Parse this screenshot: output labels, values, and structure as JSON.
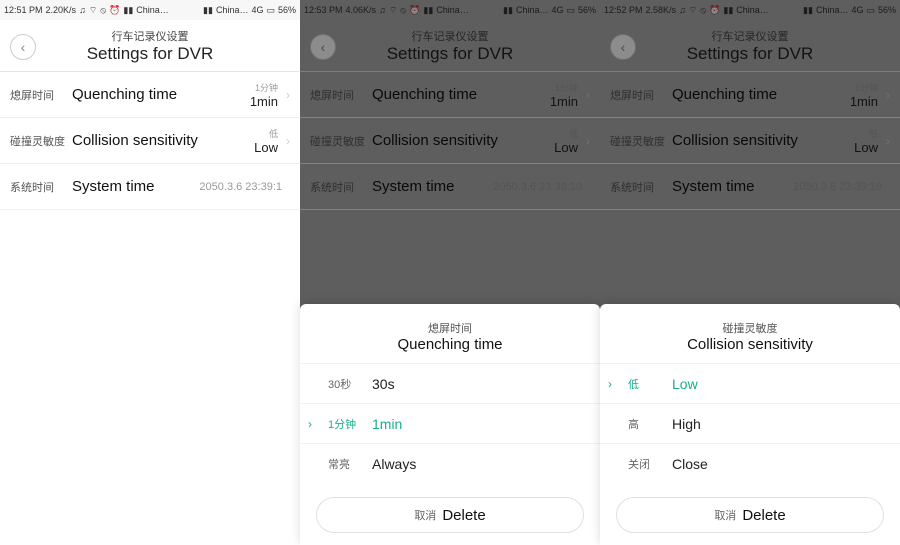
{
  "panels": [
    {
      "status": {
        "time": "12:51 PM",
        "speed": "2.20K/s",
        "carrier1": "China…",
        "carrier2": "China…",
        "signal": "4G",
        "battery": "56%"
      },
      "header": {
        "back": "‹",
        "cn": "行车记录仪设置",
        "en": "Settings for DVR"
      },
      "rows": [
        {
          "label_cn": "熄屏时间",
          "label_en": "Quenching time",
          "val_cn": "1分钟",
          "val_en": "1min"
        },
        {
          "label_cn": "碰撞灵敏度",
          "label_en": "Collision sensitivity",
          "val_cn": "低",
          "val_en": "Low"
        },
        {
          "label_cn": "系统时间",
          "label_en": "System time",
          "val_cn": "",
          "val_en": "2050.3.6 23:39:1"
        }
      ],
      "dimmed": false
    },
    {
      "status": {
        "time": "12:53 PM",
        "speed": "4.06K/s",
        "carrier1": "China…",
        "carrier2": "China…",
        "signal": "4G",
        "battery": "56%"
      },
      "header": {
        "back": "‹",
        "cn": "行车记录仪设置",
        "en": "Settings for DVR"
      },
      "rows": [
        {
          "label_cn": "熄屏时间",
          "label_en": "Quenching time",
          "val_cn": "1分钟",
          "val_en": "1min"
        },
        {
          "label_cn": "碰撞灵敏度",
          "label_en": "Collision sensitivity",
          "val_cn": "低",
          "val_en": "Low"
        },
        {
          "label_cn": "系统时间",
          "label_en": "System time",
          "val_cn": "",
          "val_en": "2050.3.6 23:38:10"
        }
      ],
      "dimmed": true,
      "sheet": {
        "title_cn": "熄屏时间",
        "title_en": "Quenching time",
        "options": [
          {
            "cn": "30秒",
            "en": "30s",
            "selected": false
          },
          {
            "cn": "1分钟",
            "en": "1min",
            "selected": true
          },
          {
            "cn": "常亮",
            "en": "Always",
            "selected": false
          }
        ],
        "delete_cn": "取消",
        "delete_en": "Delete"
      }
    },
    {
      "status": {
        "time": "12:52 PM",
        "speed": "2.58K/s",
        "carrier1": "China…",
        "carrier2": "China…",
        "signal": "4G",
        "battery": "56%"
      },
      "header": {
        "back": "‹",
        "cn": "行车记录仪设置",
        "en": "Settings for DVR"
      },
      "rows": [
        {
          "label_cn": "熄屏时间",
          "label_en": "Quenching time",
          "val_cn": "1分钟",
          "val_en": "1min"
        },
        {
          "label_cn": "碰撞灵敏度",
          "label_en": "Collision sensitivity",
          "val_cn": "低",
          "val_en": "Low"
        },
        {
          "label_cn": "系统时间",
          "label_en": "System time",
          "val_cn": "",
          "val_en": "2050.3.6 23:39:10"
        }
      ],
      "dimmed": true,
      "sheet": {
        "title_cn": "碰撞灵敏度",
        "title_en": "Collision sensitivity",
        "options": [
          {
            "cn": "低",
            "en": "Low",
            "selected": true
          },
          {
            "cn": "高",
            "en": "High",
            "selected": false
          },
          {
            "cn": "关闭",
            "en": "Close",
            "selected": false
          }
        ],
        "delete_cn": "取消",
        "delete_en": "Delete"
      }
    }
  ]
}
